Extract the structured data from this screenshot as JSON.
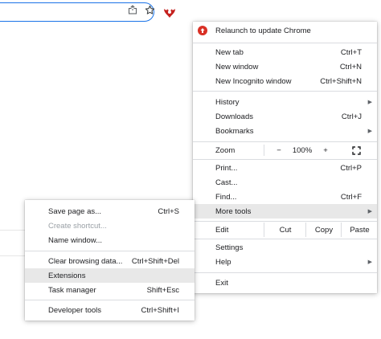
{
  "menu": {
    "relaunch_label": "Relaunch to update Chrome",
    "new_tab": {
      "label": "New tab",
      "shortcut": "Ctrl+T"
    },
    "new_window": {
      "label": "New window",
      "shortcut": "Ctrl+N"
    },
    "new_incognito": {
      "label": "New Incognito window",
      "shortcut": "Ctrl+Shift+N"
    },
    "history": {
      "label": "History"
    },
    "downloads": {
      "label": "Downloads",
      "shortcut": "Ctrl+J"
    },
    "bookmarks": {
      "label": "Bookmarks"
    },
    "zoom": {
      "label": "Zoom",
      "minus": "−",
      "value": "100%",
      "plus": "+"
    },
    "print": {
      "label": "Print...",
      "shortcut": "Ctrl+P"
    },
    "cast": {
      "label": "Cast..."
    },
    "find": {
      "label": "Find...",
      "shortcut": "Ctrl+F"
    },
    "more_tools": {
      "label": "More tools"
    },
    "edit": {
      "label": "Edit",
      "cut": "Cut",
      "copy": "Copy",
      "paste": "Paste"
    },
    "settings": {
      "label": "Settings"
    },
    "help": {
      "label": "Help"
    },
    "exit": {
      "label": "Exit"
    }
  },
  "submenu": {
    "save_page": {
      "label": "Save page as...",
      "shortcut": "Ctrl+S"
    },
    "create_shortcut": {
      "label": "Create shortcut..."
    },
    "name_window": {
      "label": "Name window..."
    },
    "clear_browsing": {
      "label": "Clear browsing data...",
      "shortcut": "Ctrl+Shift+Del"
    },
    "extensions": {
      "label": "Extensions"
    },
    "task_manager": {
      "label": "Task manager",
      "shortcut": "Shift+Esc"
    },
    "developer_tools": {
      "label": "Developer tools",
      "shortcut": "Ctrl+Shift+I"
    }
  },
  "icons": {
    "share": "share-icon",
    "bookmark_star": "star-icon",
    "profile": "profile-avatar-icon",
    "relaunch": "update-alert-icon",
    "fullscreen": "fullscreen-icon"
  },
  "colors": {
    "omnibox_border": "#1a73e8",
    "relaunch_badge": "#d93025",
    "highlight": "#e8e8e8"
  }
}
